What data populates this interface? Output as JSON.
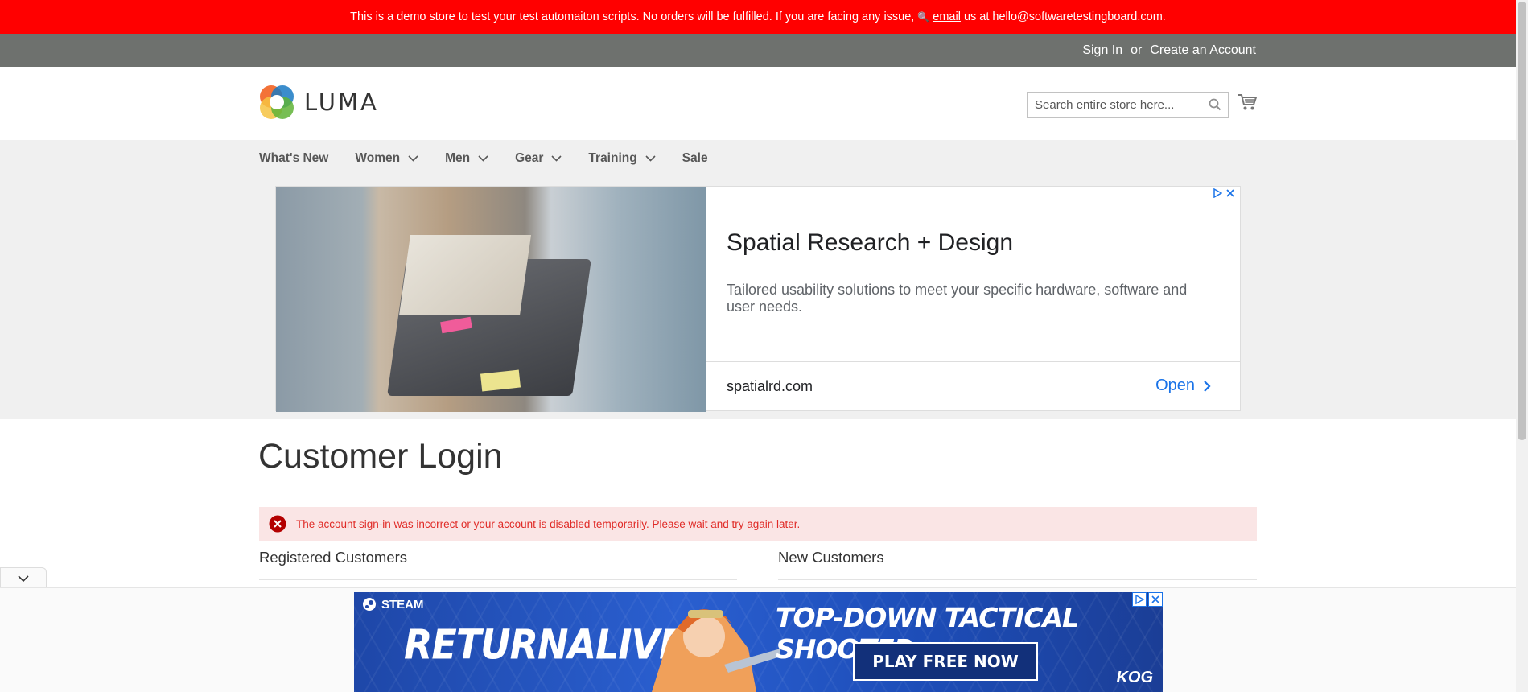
{
  "demo_banner": {
    "text_before": "This is a demo store to test your test automaiton scripts. No orders will be fulfilled. If you are facing any issue,",
    "email_link": "email",
    "text_after": "us at hello@softwaretestingboard.com."
  },
  "header_links": {
    "sign_in": "Sign In",
    "or": "or",
    "create_account": "Create an Account"
  },
  "logo": {
    "text": "LUMA",
    "icon": "luma-logo-icon"
  },
  "search": {
    "placeholder": "Search entire store here..."
  },
  "nav": {
    "items": [
      {
        "label": "What's New",
        "has_dropdown": false
      },
      {
        "label": "Women",
        "has_dropdown": true
      },
      {
        "label": "Men",
        "has_dropdown": true
      },
      {
        "label": "Gear",
        "has_dropdown": true
      },
      {
        "label": "Training",
        "has_dropdown": true
      },
      {
        "label": "Sale",
        "has_dropdown": false
      }
    ]
  },
  "ad": {
    "headline": "Spatial Research + Design",
    "description": "Tailored usability solutions to meet your specific hardware, software and user needs.",
    "domain": "spatialrd.com",
    "cta": "Open"
  },
  "page": {
    "title": "Customer Login",
    "error": "The account sign-in was incorrect or your account is disabled temporarily. Please wait and try again later.",
    "registered_title": "Registered Customers",
    "new_title": "New Customers"
  },
  "game_ad": {
    "brand": "STEAM",
    "title": "RETURNALIVE",
    "tagline": "TOP-DOWN TACTICAL SHOOTER",
    "cta": "PLAY FREE NOW",
    "publisher": "KOG"
  },
  "colors": {
    "demo_banner": "#ff0000",
    "panel_header": "#6e716e",
    "nav_bg": "#f0f0f0",
    "error_bg": "#fae5e5",
    "error_text": "#e02b27",
    "ad_link": "#1a73e8"
  }
}
